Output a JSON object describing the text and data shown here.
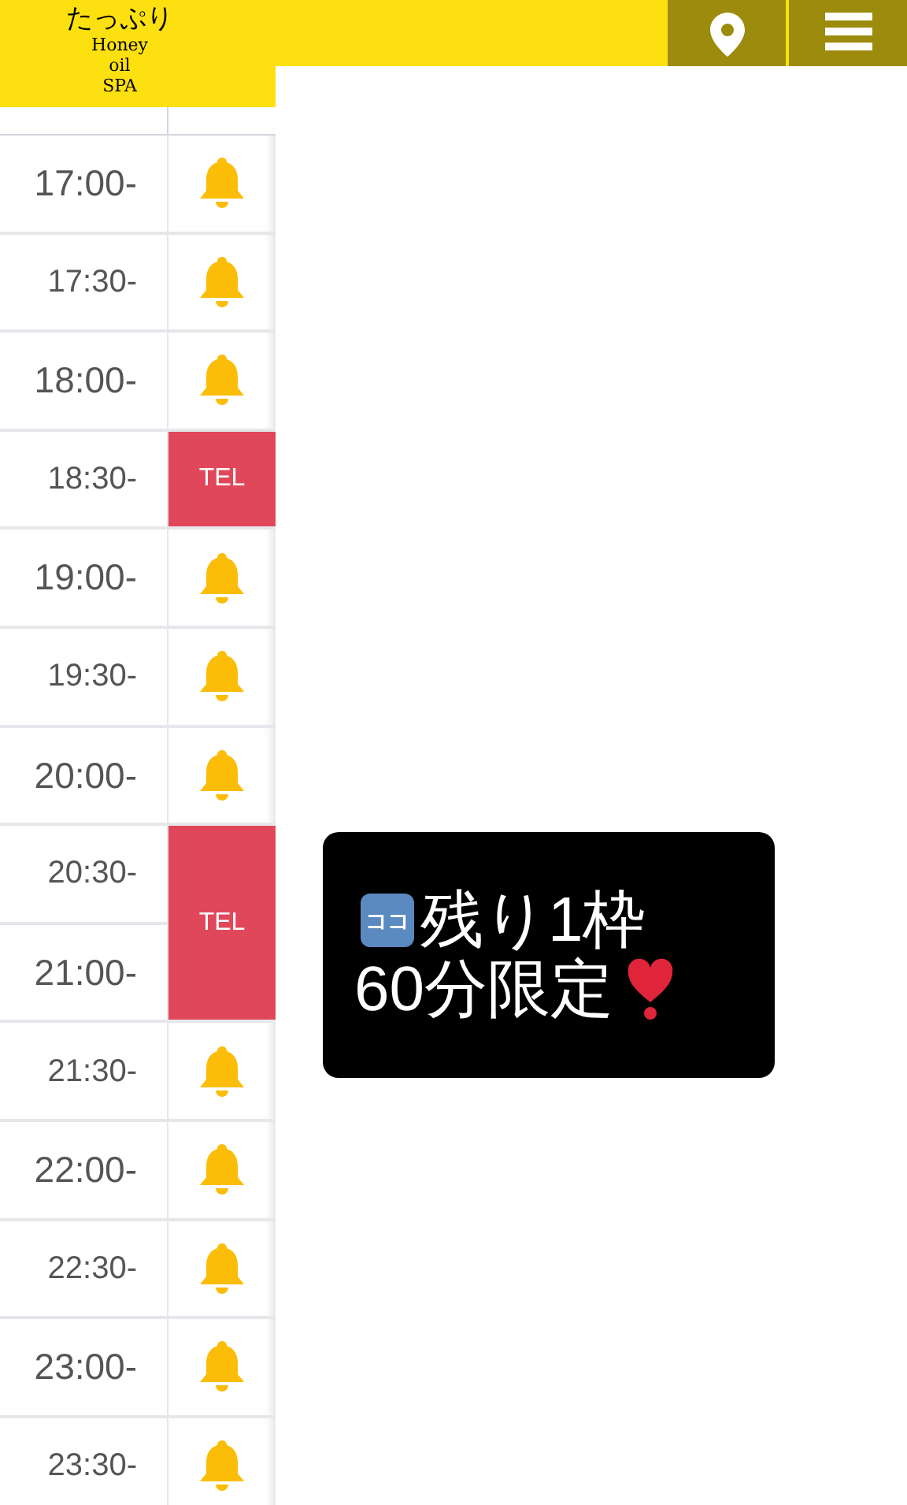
{
  "header": {
    "logo": [
      "たっぷり",
      "Honey",
      "oil",
      "SPA"
    ]
  },
  "schedule": [
    {
      "time": "17:00-",
      "kind": "hour",
      "status": {
        "kind": "bell"
      }
    },
    {
      "time": "17:30-",
      "kind": "half",
      "status": {
        "kind": "bell"
      }
    },
    {
      "time": "18:00-",
      "kind": "hour",
      "status": {
        "kind": "bell"
      }
    },
    {
      "time": "18:30-",
      "kind": "half",
      "status": {
        "kind": "tel",
        "label": "TEL"
      }
    },
    {
      "time": "19:00-",
      "kind": "hour",
      "status": {
        "kind": "bell"
      }
    },
    {
      "time": "19:30-",
      "kind": "half",
      "status": {
        "kind": "bell"
      }
    },
    {
      "time": "20:00-",
      "kind": "hour",
      "status": {
        "kind": "bell"
      }
    },
    {
      "time": "20:30-",
      "kind": "half",
      "status": {
        "kind": "tel",
        "label": "TEL"
      }
    },
    {
      "time": "21:00-",
      "kind": "hour"
    },
    {
      "time": "21:30-",
      "kind": "half",
      "status": {
        "kind": "bell"
      }
    },
    {
      "time": "22:00-",
      "kind": "hour",
      "status": {
        "kind": "bell"
      }
    },
    {
      "time": "22:30-",
      "kind": "half",
      "status": {
        "kind": "bell"
      }
    },
    {
      "time": "23:00-",
      "kind": "hour",
      "status": {
        "kind": "bell"
      }
    },
    {
      "time": "23:30-",
      "kind": "half",
      "status": {
        "kind": "bell"
      }
    }
  ],
  "notice": {
    "badge": "ココ",
    "line_1": "残り1枠",
    "line_2": "60分限定"
  }
}
